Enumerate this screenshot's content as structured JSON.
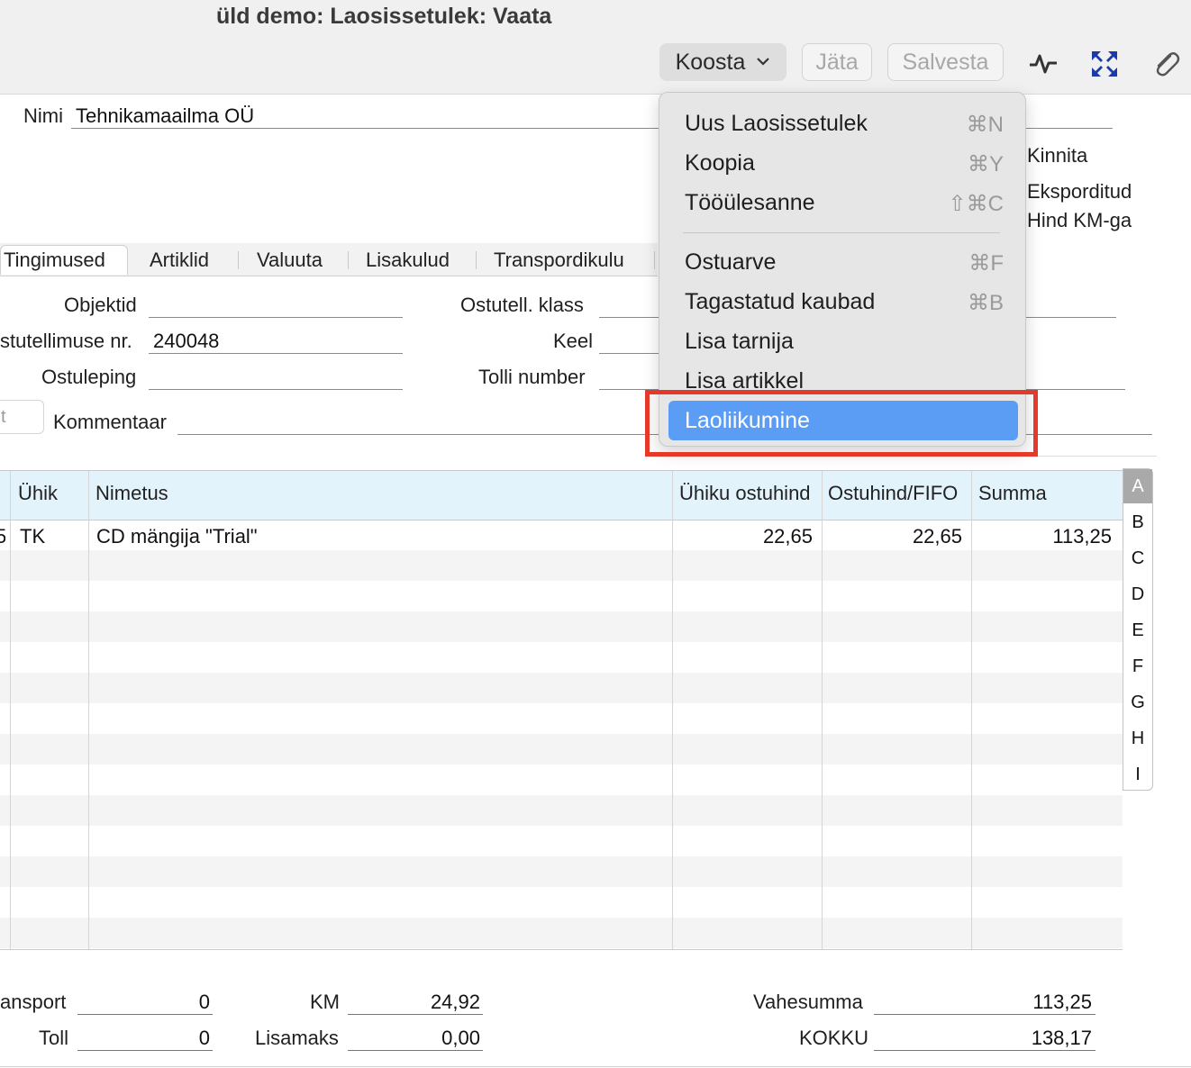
{
  "window": {
    "title": "üld demo: Laosissetulek: Vaata"
  },
  "toolbar": {
    "koosta_label": "Koosta",
    "jata_label": "Jäta",
    "salvesta_label": "Salvesta",
    "icons": [
      "activity-icon",
      "expand-icon",
      "paperclip-icon"
    ]
  },
  "header": {
    "nimi_label": "Nimi",
    "nimi_value": "Tehnikamaailma OÜ",
    "kinnita_label": "Kinnita",
    "eksporditud_label": "Eksporditud",
    "hind_km_label": "Hind KM-ga"
  },
  "tabs": [
    "Tingimused",
    "Artiklid",
    "Valuuta",
    "Lisakulud",
    "Transpordikulu"
  ],
  "form": {
    "objektid_label": "Objektid",
    "ostutell_klass_label": "Ostutell. klass",
    "ostutellimuse_nr_label": "stutellimuse nr.",
    "ostutellimuse_nr_value": "240048",
    "keel_label": "Keel",
    "ostuleping_label": "Ostuleping",
    "tolli_number_label": "Tolli number",
    "kommentaar_label": "Kommentaar",
    "left_box_text": "t"
  },
  "table": {
    "columns": [
      "Ühik",
      "Nimetus",
      "Ühiku ostuhind",
      "Ostuhind/FIFO",
      "Summa"
    ],
    "rows": [
      {
        "prefix": "5",
        "unit": "TK",
        "name": "CD mängija \"Trial\"",
        "unit_price": "22,65",
        "fifo": "22,65",
        "sum": "113,25"
      }
    ]
  },
  "alphabet": [
    "A",
    "B",
    "C",
    "D",
    "E",
    "F",
    "G",
    "H",
    "I"
  ],
  "menu": {
    "items": [
      {
        "label": "Uus Laosissetulek",
        "shortcut": "⌘N"
      },
      {
        "label": "Koopia",
        "shortcut": "⌘Y"
      },
      {
        "label": "Tööülesanne",
        "shortcut": "⇧⌘C"
      },
      {
        "label": "Ostuarve",
        "shortcut": "⌘F"
      },
      {
        "label": "Tagastatud kaubad",
        "shortcut": "⌘B"
      },
      {
        "label": "Lisa tarnija",
        "shortcut": ""
      },
      {
        "label": "Lisa artikkel",
        "shortcut": ""
      },
      {
        "label": "Laoliikumine",
        "shortcut": ""
      }
    ],
    "highlight_color": "#5b9cf5",
    "annotation_color": "#e5392a"
  },
  "footer": {
    "transport_label": "ansport",
    "transport_value": "0",
    "toll_label": "Toll",
    "toll_value": "0",
    "km_label": "KM",
    "km_value": "24,92",
    "lisamaks_label": "Lisamaks",
    "lisamaks_value": "0,00",
    "vahesumma_label": "Vahesumma",
    "vahesumma_value": "113,25",
    "kokku_label": "KOKKU",
    "kokku_value": "138,17"
  }
}
